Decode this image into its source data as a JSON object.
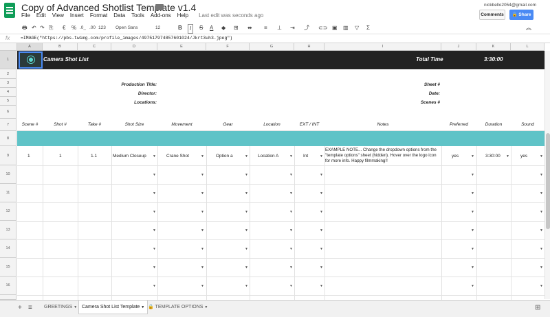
{
  "doc": {
    "title": "Copy of Advanced Shotlist Template v1.4",
    "last_edit": "Last edit was seconds ago"
  },
  "menu": [
    "File",
    "Edit",
    "View",
    "Insert",
    "Format",
    "Data",
    "Tools",
    "Add-ons",
    "Help"
  ],
  "user": {
    "email": "nickbello2054@gmail.com",
    "comments_label": "Comments",
    "share_label": "Share"
  },
  "toolbar": {
    "currency": "€",
    "percent": "%",
    "dec_less": ".0_",
    "dec_more": ".00",
    "num_format": "123",
    "font": "Open Sans",
    "size": "12",
    "bold": "B",
    "italic": "I",
    "strike": "S",
    "text_color": "A",
    "sigma": "Σ"
  },
  "formula_bar": {
    "fx": "fx",
    "text": "=IMAGE(\"https://pbs.twimg.com/profile_images/497517974857601024/Jkrt3uh3.jpeg\")"
  },
  "columns": [
    "A",
    "B",
    "C",
    "D",
    "E",
    "F",
    "G",
    "H",
    "I",
    "J",
    "K",
    "L"
  ],
  "rows": [
    "1",
    "2",
    "3",
    "4",
    "5",
    "6",
    "7",
    "8",
    "9",
    "10",
    "11",
    "12",
    "13",
    "14",
    "15",
    "16"
  ],
  "header": {
    "title": "Camera Shot List",
    "total_time_label": "Total Time",
    "total_time_value": "3:30:00"
  },
  "info": {
    "production_title": "Production Title:",
    "director": "Director:",
    "locations": "Locations:",
    "sheet": "Sheet #",
    "date": "Date:",
    "scenes": "Scenes #"
  },
  "table_headers": [
    "Scene #",
    "Shot #",
    "Take #",
    "Shot Size",
    "Movement",
    "Gear",
    "Location",
    "EXT / INT",
    "Notes",
    "Preferred",
    "Duration",
    "Sound"
  ],
  "row9": {
    "scene": "1",
    "shot": "1",
    "take": "1.1",
    "shot_size": "Medium Closeup",
    "movement": "Crane Shot",
    "gear": "Option a",
    "location": "Location A",
    "ext_int": "Int",
    "notes": "EXAMPLE NOTE... Change the dropdown options from the \"template options\" sheet (hidden). Hover over the logo icon for more info. Happy filmmaking!!",
    "preferred": "yes",
    "duration": "3:30:00",
    "sound": "yes"
  },
  "sheets": {
    "tab1": "GREETINGS",
    "tab2": "Camera Shot List Template",
    "tab3": "TEMPLATE OPTIONS"
  },
  "colors": {
    "accent_teal": "#5fc3c7",
    "header_black": "#222222",
    "share_blue": "#4a8af4"
  }
}
